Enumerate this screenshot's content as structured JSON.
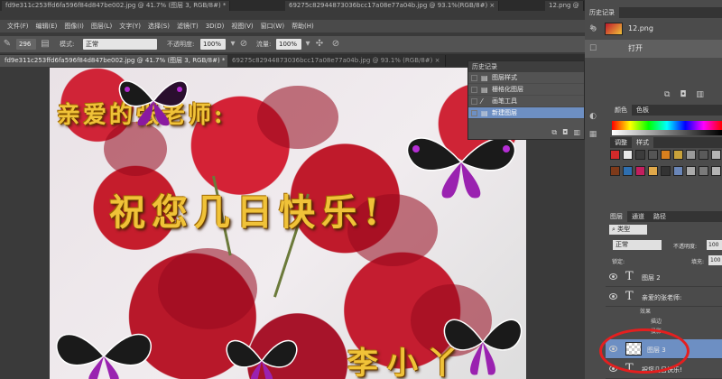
{
  "window_tabs": [
    "fd9e311c253ffd6fa596f84d847be002.jpg @ 41.7% (图层 3, RGB/8#) *",
    "69275c82944873036bcc17a08e77a04b.jpg @ 93.1%(RGB/8#) ×",
    "12.png @"
  ],
  "menu": [
    "文件(F)",
    "编辑(E)",
    "图像(I)",
    "图层(L)",
    "文字(Y)",
    "选择(S)",
    "滤镜(T)",
    "3D(D)",
    "视图(V)",
    "窗口(W)",
    "帮助(H)"
  ],
  "options": {
    "brush_size": "296",
    "mode_label": "模式:",
    "mode_value": "正常",
    "opacity_label": "不透明度:",
    "opacity_value": "100%",
    "flow_label": "流量:",
    "flow_value": "100%"
  },
  "doc_tabs": [
    {
      "label": "fd9e311c253ffd6fa596f84d847be002.jpg @ 41.7% (图层 3, RGB/8#) * ×",
      "active": true
    },
    {
      "label": "69275c82944873036bcc17a08e77a04b.jpg @ 93.1% (RGB/8#) ×",
      "active": false
    }
  ],
  "canvas_text": {
    "greeting": "亲爱的张老师:",
    "headline": "祝您几日快乐!",
    "signature": "李小丫"
  },
  "floating_history": {
    "title": "历史记录",
    "items": [
      "图层样式",
      "栅格化图层",
      "画笔工具",
      "新建图层"
    ],
    "selected": 3
  },
  "dock": {
    "history_title": "历史记录",
    "history_file": "12.png",
    "history_item": "打开",
    "color_tabs": [
      "颜色",
      "色板"
    ],
    "style_tabs": [
      "调整",
      "样式"
    ],
    "swatch_colors": [
      "#d22a2a",
      "#e8e8e8",
      "#3c3c3c",
      "#555",
      "#d87f1e",
      "#c9a23a",
      "#9a9a9a",
      "#5a5a5a",
      "#b5b5b5",
      "#7e3a1a",
      "#2e6fb0",
      "#c21f5e",
      "#e0a84a",
      "#333",
      "#6a86b8",
      "#aaa",
      "#7a7a7a",
      "#b3b3b3"
    ],
    "layers_tabs": [
      "图层",
      "通道",
      "路径"
    ],
    "kind_label": "类型",
    "blend_mode": "正常",
    "opacity_label": "不透明度:",
    "opacity_value": "100",
    "lock_label": "锁定:",
    "fill_label": "填充:",
    "fill_value": "100",
    "layers": [
      "图层 2",
      "亲爱的张老师:",
      "图层 3",
      "祝您几日快乐!"
    ],
    "effects_label": "效果",
    "effect_items": [
      "描边",
      "投影"
    ]
  }
}
